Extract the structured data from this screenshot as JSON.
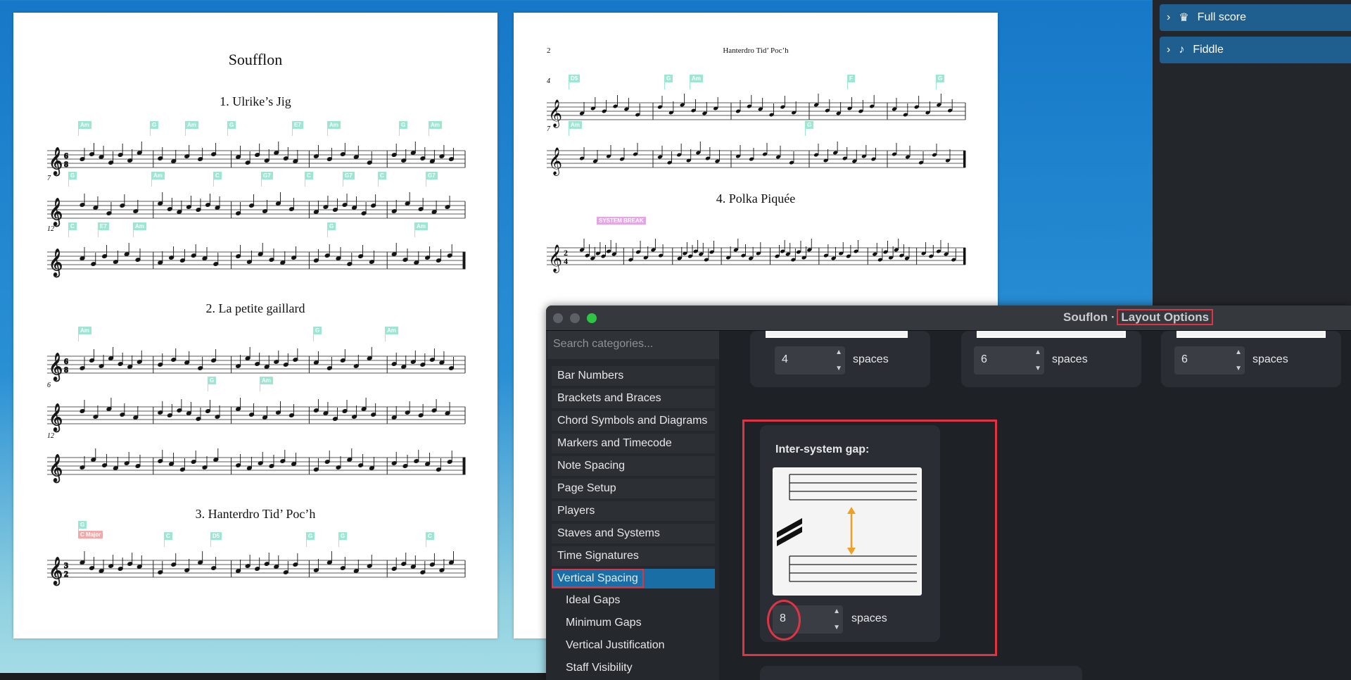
{
  "score": {
    "title": "Soufflon",
    "tunes": [
      {
        "title": "1. Ulrike’s Jig"
      },
      {
        "title": "2. La petite gaillard"
      },
      {
        "title": "3. Hanterdro Tid’ Poc’h"
      },
      {
        "title": "4. Polka Piquée"
      }
    ],
    "page2_number": "2",
    "page2_header": "Hanterdro Tid’ Poc’h",
    "bar_numbers": [
      "7",
      "12",
      "6",
      "12",
      "4",
      "7"
    ],
    "chords_p1_sys1": [
      "Am",
      "G",
      "Am",
      "G",
      "E7",
      "Am",
      "G",
      "Am"
    ],
    "chords_p1_sys2": [
      "G",
      "Am",
      "C",
      "G7",
      "C",
      "G7",
      "C",
      "G7"
    ],
    "chords_p1_sys3": [
      "C",
      "E7",
      "Am",
      "G",
      "Am"
    ],
    "chords_p1_sys4": [
      "Am",
      "G",
      "Am"
    ],
    "chords_p1_sys5": [
      "G",
      "Am"
    ],
    "chords_p1_sys7": [
      "G",
      "C",
      "D5",
      "G",
      "G",
      "G",
      "C"
    ],
    "chords_p2_sys1": [
      "D5",
      "G",
      "Am",
      "F",
      "G"
    ],
    "chords_p2_sys2": [
      "Am",
      "G"
    ],
    "key_tag": "C Major",
    "break_tag": "SYSTEM BREAK"
  },
  "right_panel": {
    "items": [
      {
        "label": "Full score"
      },
      {
        "label": "Fiddle"
      }
    ]
  },
  "dialog": {
    "title_app": "Souflon · ",
    "title_name": "Layout Options",
    "search_placeholder": "Search categories...",
    "categories": [
      "Bar Numbers",
      "Brackets and Braces",
      "Chord Symbols and Diagrams",
      "Markers and Timecode",
      "Note Spacing",
      "Page Setup",
      "Players",
      "Staves and Systems",
      "Time Signatures",
      "Vertical Spacing"
    ],
    "active_category": "Vertical Spacing",
    "subcategories": [
      "Ideal Gaps",
      "Minimum Gaps",
      "Vertical Justification",
      "Staff Visibility"
    ],
    "top_fields": [
      {
        "value": "4",
        "unit": "spaces"
      },
      {
        "value": "6",
        "unit": "spaces"
      },
      {
        "value": "6",
        "unit": "spaces"
      }
    ],
    "intersystem": {
      "label": "Inter-system gap:",
      "value": "8",
      "unit": "spaces"
    },
    "colors": {
      "accent": "#1a6ea6",
      "highlight": "#e03444",
      "arrow": "#f0a020"
    }
  }
}
